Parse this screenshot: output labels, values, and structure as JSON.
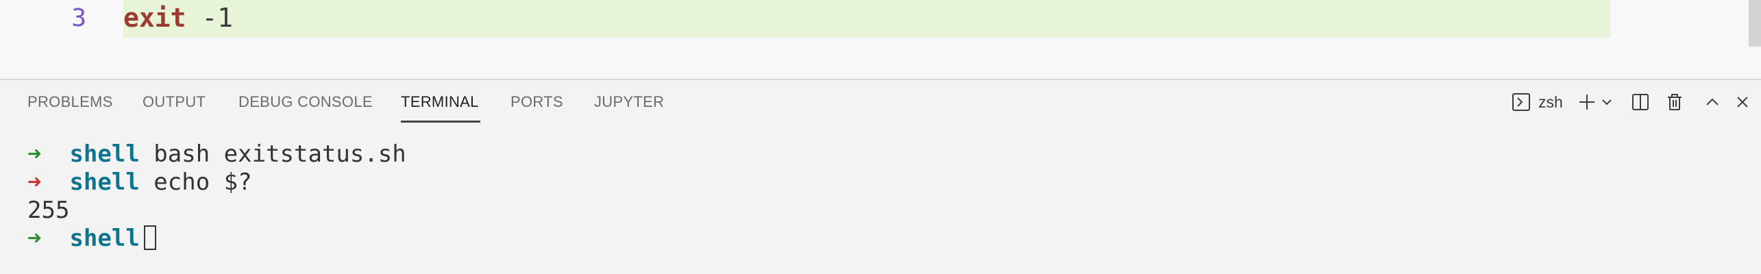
{
  "editor": {
    "line_number": "3",
    "code_keyword": "exit",
    "code_argument": "-1"
  },
  "panel": {
    "tabs": [
      {
        "label": "PROBLEMS"
      },
      {
        "label": "OUTPUT"
      },
      {
        "label": "DEBUG CONSOLE"
      },
      {
        "label": "TERMINAL",
        "active": true
      },
      {
        "label": "PORTS"
      },
      {
        "label": "JUPYTER"
      }
    ],
    "toolbar": {
      "shell_name": "zsh",
      "icons": [
        "terminal-icon",
        "plus-icon",
        "chevron-down-icon",
        "split-icon",
        "trash-icon",
        "chevron-up-icon",
        "close-icon"
      ]
    }
  },
  "terminal": {
    "lines": [
      {
        "arrow": "➜",
        "status": "ok",
        "dir": "shell",
        "command": "bash exitstatus.sh"
      },
      {
        "arrow": "➜",
        "status": "error",
        "dir": "shell",
        "command": "echo $?"
      },
      {
        "output": "255"
      },
      {
        "arrow": "➜",
        "status": "ok",
        "dir": "shell",
        "command": ""
      }
    ]
  },
  "colors": {
    "line_highlight": "#e7f4d7",
    "keyword": "#9c3b30",
    "line_number": "#7b53c4",
    "prompt_ok": "#2e8b2e",
    "prompt_error": "#cc3333",
    "directory": "#0e7490"
  }
}
